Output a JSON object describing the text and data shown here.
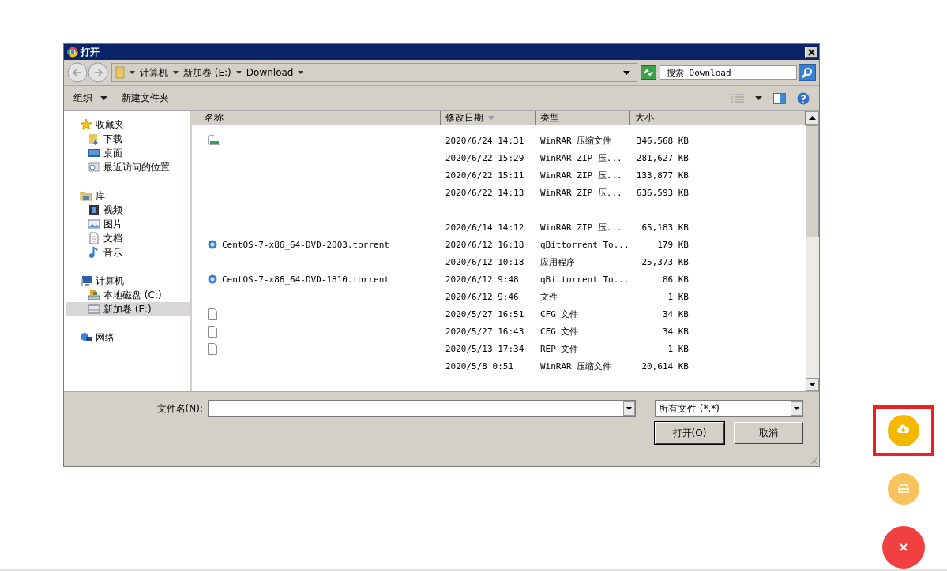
{
  "dialog": {
    "title": "打开",
    "breadcrumb": [
      "计算机",
      "新加卷 (E:)",
      "Download"
    ],
    "search": {
      "placeholder": "搜索 Download"
    },
    "toolbar": [
      {
        "label": "组织",
        "kind": "menu"
      },
      {
        "label": "新建文件夹",
        "kind": "button"
      }
    ],
    "sidebar": [
      {
        "label": "收藏夹",
        "selected": false,
        "children": [
          {
            "label": "下载",
            "selected": false
          },
          {
            "label": "桌面",
            "selected": false
          },
          {
            "label": "最近访问的位置",
            "selected": false
          }
        ]
      },
      {
        "label": "库",
        "selected": false,
        "children": [
          {
            "label": "视频",
            "selected": false
          },
          {
            "label": "图片",
            "selected": false
          },
          {
            "label": "文档",
            "selected": false
          },
          {
            "label": "音乐",
            "selected": false
          }
        ]
      },
      {
        "label": "计算机",
        "selected": false,
        "children": [
          {
            "label": "本地磁盘 (C:)",
            "selected": false
          },
          {
            "label": "新加卷 (E:)",
            "selected": true
          }
        ]
      },
      {
        "label": "网络",
        "selected": false
      }
    ],
    "columns": [
      {
        "label": "名称",
        "sorted": false
      },
      {
        "label": "修改日期",
        "sorted": true
      },
      {
        "label": "类型",
        "sorted": false
      },
      {
        "label": "大小",
        "sorted": false
      }
    ],
    "rows": [
      {
        "kind": "archive",
        "date": "2020/6/24 14:31",
        "type": "WinRAR 压缩文件",
        "size": "346,568 KB"
      },
      {
        "kind": "file",
        "date": "2020/6/22 15:29",
        "type": "WinRAR ZIP 压...",
        "size": "281,627 KB"
      },
      {
        "kind": "file",
        "date": "2020/6/22 15:11",
        "type": "WinRAR ZIP 压...",
        "size": "133,877 KB"
      },
      {
        "kind": "file",
        "date": "2020/6/22 14:13",
        "type": "WinRAR ZIP 压...",
        "size": "636,593 KB"
      },
      {
        "kind": "erased"
      },
      {
        "kind": "file",
        "date": "2020/6/14 14:12",
        "type": "WinRAR ZIP 压...",
        "size": "65,183 KB"
      },
      {
        "kind": "torrent",
        "name": "CentOS-7-x86_64-DVD-2003.torrent",
        "date": "2020/6/12 16:18",
        "type": "qBittorrent To...",
        "size": "179 KB"
      },
      {
        "kind": "file",
        "date": "2020/6/12 10:18",
        "type": "应用程序",
        "size": "25,373 KB"
      },
      {
        "kind": "torrent",
        "name": "CentOS-7-x86_64-DVD-1810.torrent",
        "date": "2020/6/12 9:48",
        "type": "qBittorrent To...",
        "size": "86 KB"
      },
      {
        "kind": "file",
        "date": "2020/6/12 9:46",
        "type": "文件",
        "size": "1 KB"
      },
      {
        "kind": "page",
        "date": "2020/5/27 16:51",
        "type": "CFG 文件",
        "size": "34 KB"
      },
      {
        "kind": "page",
        "date": "2020/5/27 16:43",
        "type": "CFG 文件",
        "size": "34 KB"
      },
      {
        "kind": "page",
        "date": "2020/5/13 17:34",
        "type": "REP 文件",
        "size": "1 KB"
      },
      {
        "kind": "file",
        "date": "2020/5/8 0:51",
        "type": "WinRAR 压缩文件",
        "size": "20,614 KB"
      },
      {
        "kind": "erased"
      }
    ],
    "filename": {
      "label": "文件名(N):"
    },
    "filetype": {
      "value": "所有文件 (*.*)"
    },
    "buttons": [
      {
        "label": "打开(O)",
        "default": true
      },
      {
        "label": "取消",
        "default": false
      }
    ]
  },
  "fabs": [
    {
      "kind": "upload",
      "color": "#f5b800",
      "highlighted": true
    },
    {
      "kind": "drawer",
      "color": "#f7c35a",
      "highlighted": false
    },
    {
      "kind": "close",
      "color": "#f04040",
      "highlighted": false
    }
  ]
}
